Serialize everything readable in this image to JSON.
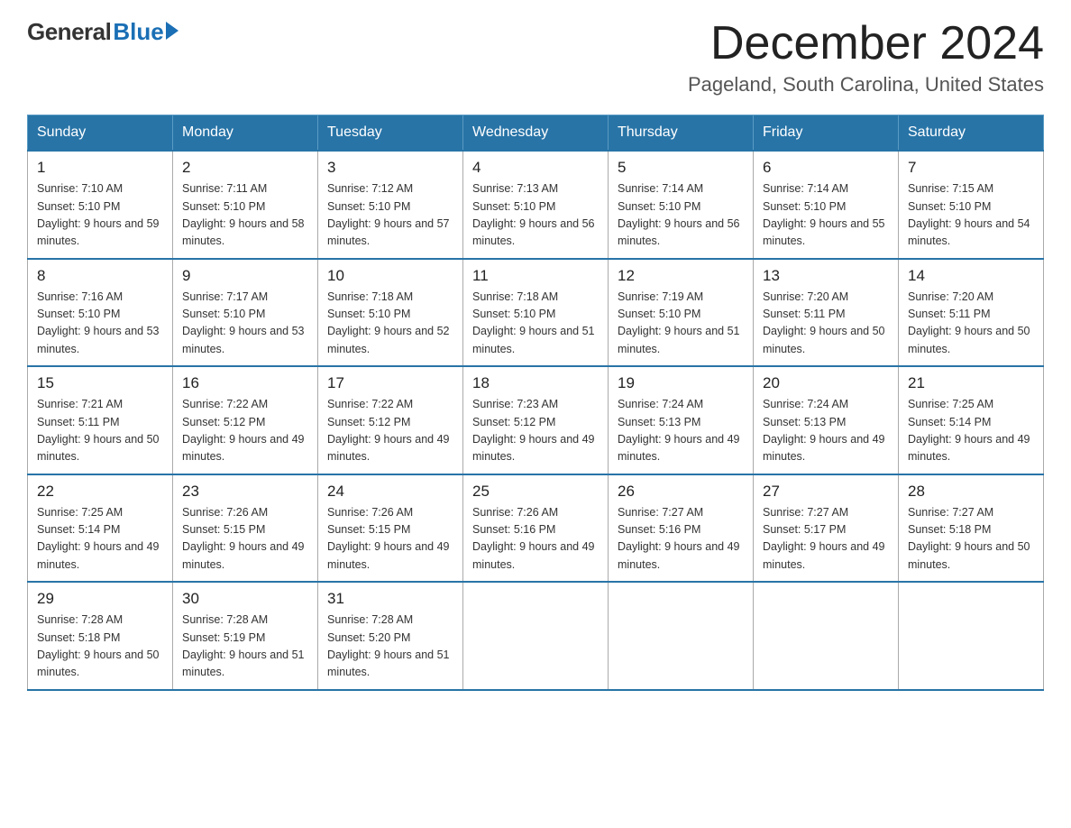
{
  "header": {
    "logo": {
      "general": "General",
      "blue": "Blue",
      "arrow": true
    },
    "title": "December 2024",
    "location": "Pageland, South Carolina, United States"
  },
  "calendar": {
    "days_of_week": [
      "Sunday",
      "Monday",
      "Tuesday",
      "Wednesday",
      "Thursday",
      "Friday",
      "Saturday"
    ],
    "weeks": [
      [
        {
          "day": "1",
          "sunrise": "7:10 AM",
          "sunset": "5:10 PM",
          "daylight": "9 hours and 59 minutes."
        },
        {
          "day": "2",
          "sunrise": "7:11 AM",
          "sunset": "5:10 PM",
          "daylight": "9 hours and 58 minutes."
        },
        {
          "day": "3",
          "sunrise": "7:12 AM",
          "sunset": "5:10 PM",
          "daylight": "9 hours and 57 minutes."
        },
        {
          "day": "4",
          "sunrise": "7:13 AM",
          "sunset": "5:10 PM",
          "daylight": "9 hours and 56 minutes."
        },
        {
          "day": "5",
          "sunrise": "7:14 AM",
          "sunset": "5:10 PM",
          "daylight": "9 hours and 56 minutes."
        },
        {
          "day": "6",
          "sunrise": "7:14 AM",
          "sunset": "5:10 PM",
          "daylight": "9 hours and 55 minutes."
        },
        {
          "day": "7",
          "sunrise": "7:15 AM",
          "sunset": "5:10 PM",
          "daylight": "9 hours and 54 minutes."
        }
      ],
      [
        {
          "day": "8",
          "sunrise": "7:16 AM",
          "sunset": "5:10 PM",
          "daylight": "9 hours and 53 minutes."
        },
        {
          "day": "9",
          "sunrise": "7:17 AM",
          "sunset": "5:10 PM",
          "daylight": "9 hours and 53 minutes."
        },
        {
          "day": "10",
          "sunrise": "7:18 AM",
          "sunset": "5:10 PM",
          "daylight": "9 hours and 52 minutes."
        },
        {
          "day": "11",
          "sunrise": "7:18 AM",
          "sunset": "5:10 PM",
          "daylight": "9 hours and 51 minutes."
        },
        {
          "day": "12",
          "sunrise": "7:19 AM",
          "sunset": "5:10 PM",
          "daylight": "9 hours and 51 minutes."
        },
        {
          "day": "13",
          "sunrise": "7:20 AM",
          "sunset": "5:11 PM",
          "daylight": "9 hours and 50 minutes."
        },
        {
          "day": "14",
          "sunrise": "7:20 AM",
          "sunset": "5:11 PM",
          "daylight": "9 hours and 50 minutes."
        }
      ],
      [
        {
          "day": "15",
          "sunrise": "7:21 AM",
          "sunset": "5:11 PM",
          "daylight": "9 hours and 50 minutes."
        },
        {
          "day": "16",
          "sunrise": "7:22 AM",
          "sunset": "5:12 PM",
          "daylight": "9 hours and 49 minutes."
        },
        {
          "day": "17",
          "sunrise": "7:22 AM",
          "sunset": "5:12 PM",
          "daylight": "9 hours and 49 minutes."
        },
        {
          "day": "18",
          "sunrise": "7:23 AM",
          "sunset": "5:12 PM",
          "daylight": "9 hours and 49 minutes."
        },
        {
          "day": "19",
          "sunrise": "7:24 AM",
          "sunset": "5:13 PM",
          "daylight": "9 hours and 49 minutes."
        },
        {
          "day": "20",
          "sunrise": "7:24 AM",
          "sunset": "5:13 PM",
          "daylight": "9 hours and 49 minutes."
        },
        {
          "day": "21",
          "sunrise": "7:25 AM",
          "sunset": "5:14 PM",
          "daylight": "9 hours and 49 minutes."
        }
      ],
      [
        {
          "day": "22",
          "sunrise": "7:25 AM",
          "sunset": "5:14 PM",
          "daylight": "9 hours and 49 minutes."
        },
        {
          "day": "23",
          "sunrise": "7:26 AM",
          "sunset": "5:15 PM",
          "daylight": "9 hours and 49 minutes."
        },
        {
          "day": "24",
          "sunrise": "7:26 AM",
          "sunset": "5:15 PM",
          "daylight": "9 hours and 49 minutes."
        },
        {
          "day": "25",
          "sunrise": "7:26 AM",
          "sunset": "5:16 PM",
          "daylight": "9 hours and 49 minutes."
        },
        {
          "day": "26",
          "sunrise": "7:27 AM",
          "sunset": "5:16 PM",
          "daylight": "9 hours and 49 minutes."
        },
        {
          "day": "27",
          "sunrise": "7:27 AM",
          "sunset": "5:17 PM",
          "daylight": "9 hours and 49 minutes."
        },
        {
          "day": "28",
          "sunrise": "7:27 AM",
          "sunset": "5:18 PM",
          "daylight": "9 hours and 50 minutes."
        }
      ],
      [
        {
          "day": "29",
          "sunrise": "7:28 AM",
          "sunset": "5:18 PM",
          "daylight": "9 hours and 50 minutes."
        },
        {
          "day": "30",
          "sunrise": "7:28 AM",
          "sunset": "5:19 PM",
          "daylight": "9 hours and 51 minutes."
        },
        {
          "day": "31",
          "sunrise": "7:28 AM",
          "sunset": "5:20 PM",
          "daylight": "9 hours and 51 minutes."
        },
        null,
        null,
        null,
        null
      ]
    ]
  }
}
